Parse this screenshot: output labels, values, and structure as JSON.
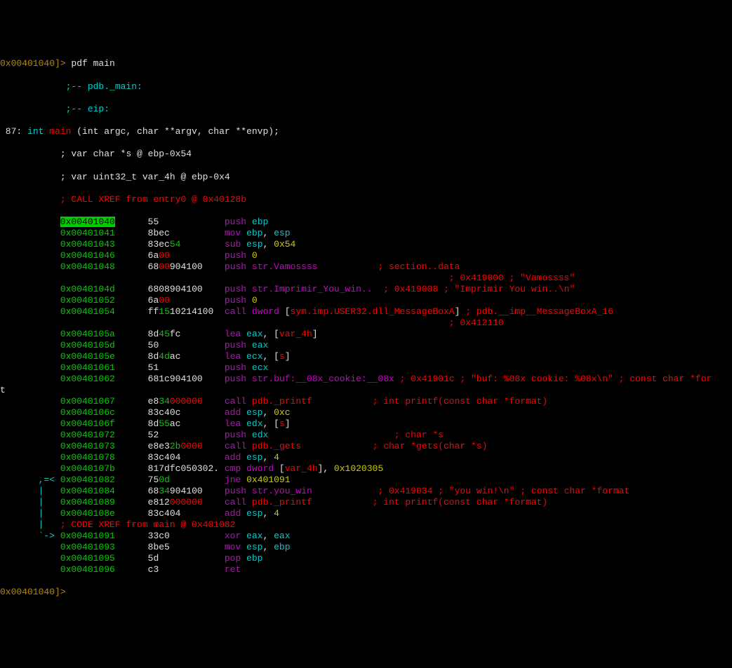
{
  "prompt_top": "0x00401040",
  "pbracket": "]>",
  "command": " pdf main",
  "header": {
    "pdb": "            ;-- pdb._main:",
    "eip": "            ;-- eip:",
    "sig_pre": " 87: ",
    "sig_int": "int",
    "sig_main": " main ",
    "sig_args": "(int argc, char **argv, char **envp);",
    "var1": "           ; var char *",
    "var1_name": "s",
    "var1_rest": " @ ebp-0x54",
    "var2": "           ; var uint32_t ",
    "var2_name": "var_4h",
    "var2_rest": " @ ebp-0x4",
    "xref": "           ; CALL XREF from entry0 @ 0x40128b"
  },
  "rows": [
    {
      "flow": "           ",
      "addr": "0x00401040",
      "addr_hl": true,
      "pad": "      ",
      "hex": "55            ",
      "mnem": "push",
      "args": " ebp",
      "arg_color": "cyan"
    },
    {
      "flow": "           ",
      "addr": "0x00401041",
      "pad": "      ",
      "hex": "8bec          ",
      "mnem": "mov",
      "args_parts": [
        {
          "t": " ebp",
          "c": "cyan"
        },
        {
          "t": ", ",
          "c": "white"
        },
        {
          "t": "esp",
          "c": "cyan"
        }
      ]
    },
    {
      "flow": "           ",
      "addr": "0x00401043",
      "pad": "      ",
      "hex": "83ec",
      "hex2": "54",
      "hex2_color": "green",
      "pad2": "        ",
      "mnem": "sub",
      "args_parts": [
        {
          "t": " esp",
          "c": "cyan"
        },
        {
          "t": ", ",
          "c": "white"
        },
        {
          "t": "0x54",
          "c": "yellow"
        }
      ]
    },
    {
      "flow": "           ",
      "addr": "0x00401046",
      "pad": "      ",
      "hex": "6a",
      "hex2": "00",
      "hex2_color": "red",
      "pad2": "          ",
      "mnem": "push",
      "args_parts": [
        {
          "t": " 0",
          "c": "yellow"
        }
      ]
    },
    {
      "flow": "           ",
      "addr": "0x00401048",
      "pad": "      ",
      "hex": "68",
      "hex2": "00",
      "hex2_color": "red",
      "hex3": "904100",
      "pad2": "    ",
      "mnem": "push",
      "args_parts": [
        {
          "t": " str.Vamossss",
          "c": "magenta"
        }
      ],
      "comment": "           ; section..data"
    },
    {
      "flow": "           ",
      "only_comment": true,
      "comment": "                                                                       ; 0x419000 ; \"Vamossss\""
    },
    {
      "flow": "           ",
      "addr": "0x0040104d",
      "pad": "      ",
      "hex": "6808904100    ",
      "mnem": "push",
      "args_parts": [
        {
          "t": " str.Imprimir_You_win..",
          "c": "magenta"
        }
      ],
      "comment": "  ; 0x419008 ; \"Imprimir You win..\\n\""
    },
    {
      "flow": "           ",
      "addr": "0x00401052",
      "pad": "      ",
      "hex": "6a",
      "hex2": "00",
      "hex2_color": "red",
      "pad2": "          ",
      "mnem": "push",
      "args_parts": [
        {
          "t": " 0",
          "c": "yellow"
        }
      ]
    },
    {
      "flow": "           ",
      "addr": "0x00401054",
      "pad": "      ",
      "hex_parts": [
        {
          "t": "ff",
          "c": "white"
        },
        {
          "t": "15",
          "c": "green"
        },
        {
          "t": "10214100",
          "c": "white"
        }
      ],
      "pad2": "  ",
      "mnem": "call dword",
      "args_parts": [
        {
          "t": " [",
          "c": "white"
        },
        {
          "t": "sym.imp.USER32.dll_MessageBoxA",
          "c": "red"
        },
        {
          "t": "]",
          "c": "white"
        }
      ],
      "comment": " ; pdb.__imp__MessageBoxA_16"
    },
    {
      "flow": "           ",
      "only_comment": true,
      "comment": "                                                                       ; 0x412110"
    },
    {
      "flow": "           ",
      "addr": "0x0040105a",
      "pad": "      ",
      "hex": "8d",
      "hex2": "45",
      "hex2_color": "green",
      "hex3": "fc",
      "pad2": "        ",
      "mnem": "lea",
      "args_parts": [
        {
          "t": " eax",
          "c": "cyan"
        },
        {
          "t": ", [",
          "c": "white"
        },
        {
          "t": "var_4h",
          "c": "red"
        },
        {
          "t": "]",
          "c": "white"
        }
      ]
    },
    {
      "flow": "           ",
      "addr": "0x0040105d",
      "pad": "      ",
      "hex": "50            ",
      "mnem": "push",
      "args_parts": [
        {
          "t": " eax",
          "c": "cyan"
        }
      ]
    },
    {
      "flow": "           ",
      "addr": "0x0040105e",
      "pad": "      ",
      "hex": "8d",
      "hex2": "4d",
      "hex2_color": "green",
      "hex3": "ac",
      "pad2": "        ",
      "mnem": "lea",
      "args_parts": [
        {
          "t": " ecx",
          "c": "cyan"
        },
        {
          "t": ", [",
          "c": "white"
        },
        {
          "t": "s",
          "c": "red"
        },
        {
          "t": "]",
          "c": "white"
        }
      ]
    },
    {
      "flow": "           ",
      "addr": "0x00401061",
      "pad": "      ",
      "hex": "51            ",
      "mnem": "push",
      "args_parts": [
        {
          "t": " ecx",
          "c": "cyan"
        }
      ]
    },
    {
      "flow": "           ",
      "addr": "0x00401062",
      "pad": "      ",
      "hex": "681c904100    ",
      "mnem": "push",
      "args_parts": [
        {
          "t": " str.buf:__08x_cookie:__08x",
          "c": "magenta"
        }
      ],
      "comment": " ; 0x41901c ; \"buf: %08x cookie: %08x\\n\" ; const char *for"
    },
    {
      "flow": "",
      "only_text": "t"
    },
    {
      "flow": "           ",
      "addr": "0x00401067",
      "pad": "      ",
      "hex_parts": [
        {
          "t": "e8",
          "c": "white"
        },
        {
          "t": "34",
          "c": "green"
        },
        {
          "t": "000000",
          "c": "red"
        }
      ],
      "pad2": "    ",
      "mnem": "call",
      "args_parts": [
        {
          "t": " pdb._printf",
          "c": "red"
        }
      ],
      "comment": "           ; int printf(const char *format)"
    },
    {
      "flow": "           ",
      "addr": "0x0040106c",
      "pad": "      ",
      "hex": "83c40c        ",
      "mnem": "add",
      "args_parts": [
        {
          "t": " esp",
          "c": "cyan"
        },
        {
          "t": ", ",
          "c": "white"
        },
        {
          "t": "0xc",
          "c": "yellow"
        }
      ]
    },
    {
      "flow": "           ",
      "addr": "0x0040106f",
      "pad": "      ",
      "hex": "8d",
      "hex2": "55",
      "hex2_color": "green",
      "hex3": "ac",
      "pad2": "        ",
      "mnem": "lea",
      "args_parts": [
        {
          "t": " edx",
          "c": "cyan"
        },
        {
          "t": ", [",
          "c": "white"
        },
        {
          "t": "s",
          "c": "red"
        },
        {
          "t": "]",
          "c": "white"
        }
      ]
    },
    {
      "flow": "           ",
      "addr": "0x00401072",
      "pad": "      ",
      "hex": "52            ",
      "mnem": "push",
      "args_parts": [
        {
          "t": " edx",
          "c": "cyan"
        }
      ],
      "comment": "                       ; char *s"
    },
    {
      "flow": "           ",
      "addr": "0x00401073",
      "pad": "      ",
      "hex_parts": [
        {
          "t": "e8e3",
          "c": "white"
        },
        {
          "t": "2b",
          "c": "green"
        },
        {
          "t": "0000",
          "c": "red"
        }
      ],
      "pad2": "    ",
      "mnem": "call",
      "args_parts": [
        {
          "t": " pdb._gets",
          "c": "red"
        }
      ],
      "comment": "             ; char *gets(char *s)"
    },
    {
      "flow": "           ",
      "addr": "0x00401078",
      "pad": "      ",
      "hex": "83c404        ",
      "mnem": "add",
      "args_parts": [
        {
          "t": " esp",
          "c": "cyan"
        },
        {
          "t": ", ",
          "c": "white"
        },
        {
          "t": "4",
          "c": "yellow"
        }
      ]
    },
    {
      "flow": "           ",
      "addr": "0x0040107b",
      "pad": "      ",
      "hex": "817dfc050302. ",
      "mnem": "cmp dword",
      "args_parts": [
        {
          "t": " [",
          "c": "white"
        },
        {
          "t": "var_4h",
          "c": "red"
        },
        {
          "t": "], ",
          "c": "white"
        },
        {
          "t": "0x1020305",
          "c": "yellow"
        }
      ]
    },
    {
      "flow": "       ,=< ",
      "flow_color": "cyan",
      "addr": "0x00401082",
      "pad": "      ",
      "hex": "75",
      "hex2": "0d",
      "hex2_color": "green",
      "pad2": "          ",
      "mnem": "jne",
      "args_parts": [
        {
          "t": " 0x401091",
          "c": "yellow"
        }
      ]
    },
    {
      "flow": "       |   ",
      "flow_color": "cyan",
      "addr": "0x00401084",
      "pad": "      ",
      "hex": "68",
      "hex2": "34",
      "hex2_color": "green",
      "hex3": "904100",
      "pad2": "    ",
      "mnem": "push",
      "args_parts": [
        {
          "t": " str.you_win",
          "c": "magenta"
        }
      ],
      "comment": "            ; 0x419034 ; \"you win!\\n\" ; const char *format"
    },
    {
      "flow": "       |   ",
      "flow_color": "cyan",
      "addr": "0x00401089",
      "pad": "      ",
      "hex_parts": [
        {
          "t": "e812",
          "c": "white"
        },
        {
          "t": "000000",
          "c": "red"
        }
      ],
      "pad2": "    ",
      "mnem": "call",
      "args_parts": [
        {
          "t": " pdb._printf",
          "c": "red"
        }
      ],
      "comment": "           ; int printf(const char *format)"
    },
    {
      "flow": "       |   ",
      "flow_color": "cyan",
      "addr": "0x0040108e",
      "pad": "      ",
      "hex": "83c404        ",
      "mnem": "add",
      "args_parts": [
        {
          "t": " esp",
          "c": "cyan"
        },
        {
          "t": ", ",
          "c": "white"
        },
        {
          "t": "4",
          "c": "yellow"
        }
      ]
    },
    {
      "flow": "       |   ",
      "flow_color": "cyan",
      "xref_text": "; CODE XREF from main @ 0x401082"
    },
    {
      "flow": "       `-> ",
      "flow_color": "cyan",
      "addr": "0x00401091",
      "pad": "      ",
      "hex": "33c0          ",
      "mnem": "xor",
      "args_parts": [
        {
          "t": " eax",
          "c": "cyan"
        },
        {
          "t": ", ",
          "c": "white"
        },
        {
          "t": "eax",
          "c": "cyan"
        }
      ]
    },
    {
      "flow": "           ",
      "addr": "0x00401093",
      "pad": "      ",
      "hex": "8be5          ",
      "mnem": "mov",
      "args_parts": [
        {
          "t": " esp",
          "c": "cyan"
        },
        {
          "t": ", ",
          "c": "white"
        },
        {
          "t": "ebp",
          "c": "cyan"
        }
      ]
    },
    {
      "flow": "           ",
      "addr": "0x00401095",
      "pad": "      ",
      "hex": "5d            ",
      "mnem": "pop",
      "args_parts": [
        {
          "t": " ebp",
          "c": "cyan"
        }
      ]
    },
    {
      "flow": "           ",
      "addr": "0x00401096",
      "pad": "      ",
      "hex": "c3            ",
      "mnem": "ret",
      "args_parts": []
    }
  ],
  "prompt_bottom": "0x00401040",
  "cursor": " "
}
